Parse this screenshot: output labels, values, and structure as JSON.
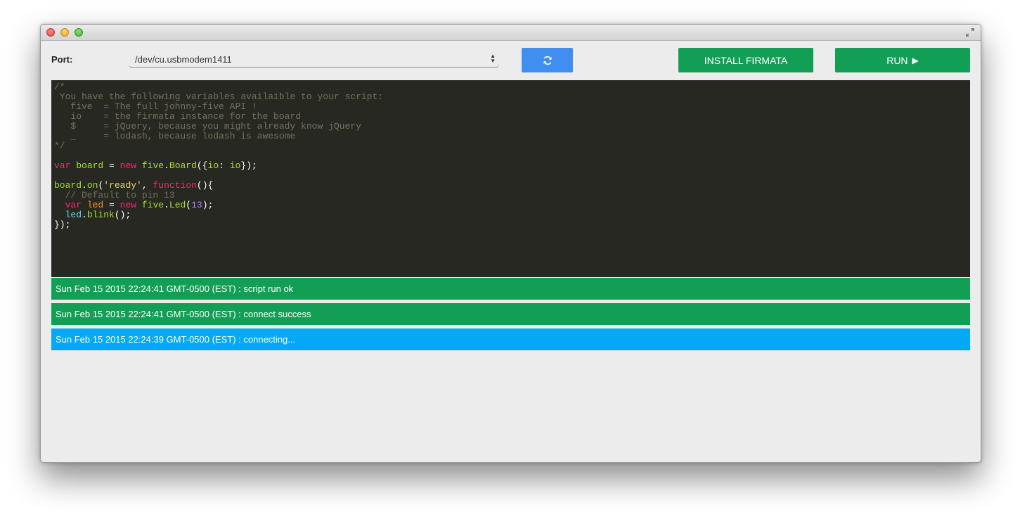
{
  "window": {
    "colors": {
      "green": "#139e56",
      "blue": "#03a9f4",
      "refresh": "#3f8ef0",
      "editor_bg": "#272822"
    }
  },
  "toolbar": {
    "port_label": "Port:",
    "port_value": "/dev/cu.usbmodem1411",
    "refresh_icon": "refresh-icon",
    "install_label": "INSTALL FIRMATA",
    "run_label": "RUN",
    "run_icon": "play-icon"
  },
  "editor": {
    "lines": [
      "/*",
      " You have the following variables availaible to your script:",
      "   five  = The full johnny-five API !",
      "   io    = the firmata instance for the board",
      "   $     = jQuery, because you might already know jQuery",
      "   _     = lodash, because lodash is awesome",
      "*/",
      "",
      "var board = new five.Board({io: io});",
      "",
      "board.on('ready', function(){",
      "  // Default to pin 13",
      "  var led = new five.Led(13);",
      "  led.blink();",
      "});"
    ]
  },
  "logs": [
    {
      "text": "Sun Feb 15 2015 22:24:41 GMT-0500 (EST) : script run ok",
      "status": "success"
    },
    {
      "text": "Sun Feb 15 2015 22:24:41 GMT-0500 (EST) : connect success",
      "status": "success"
    },
    {
      "text": "Sun Feb 15 2015 22:24:39 GMT-0500 (EST) : connecting...",
      "status": "info"
    }
  ]
}
